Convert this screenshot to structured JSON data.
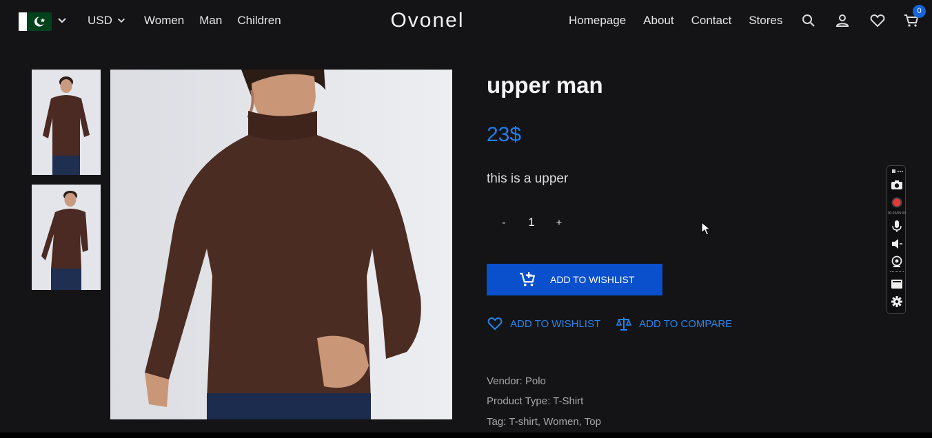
{
  "header": {
    "currency": "USD",
    "nav_left": [
      "Women",
      "Man",
      "Children"
    ],
    "brand": "Ovonel",
    "nav_right": [
      "Homepage",
      "About",
      "Contact",
      "Stores"
    ],
    "cart_count": "0"
  },
  "product": {
    "title": "upper man",
    "price": "23$",
    "description": "this is a upper",
    "quantity": "1",
    "minus_label": "-",
    "plus_label": "+",
    "add_to_cart_label": "ADD TO WISHLIST",
    "wishlist_label": "ADD TO WISHLIST",
    "compare_label": "ADD TO COMPARE",
    "vendor": "Vendor: Polo",
    "product_type": "Product Type: T-Shirt",
    "tags": "Tag: T-shirt, Women, Top"
  },
  "recorder": {
    "time": "00:15/05:00"
  },
  "colors": {
    "background": "#141416",
    "accent": "#1e7ff0",
    "button": "#0a4fcc",
    "badge": "#1565d8"
  }
}
